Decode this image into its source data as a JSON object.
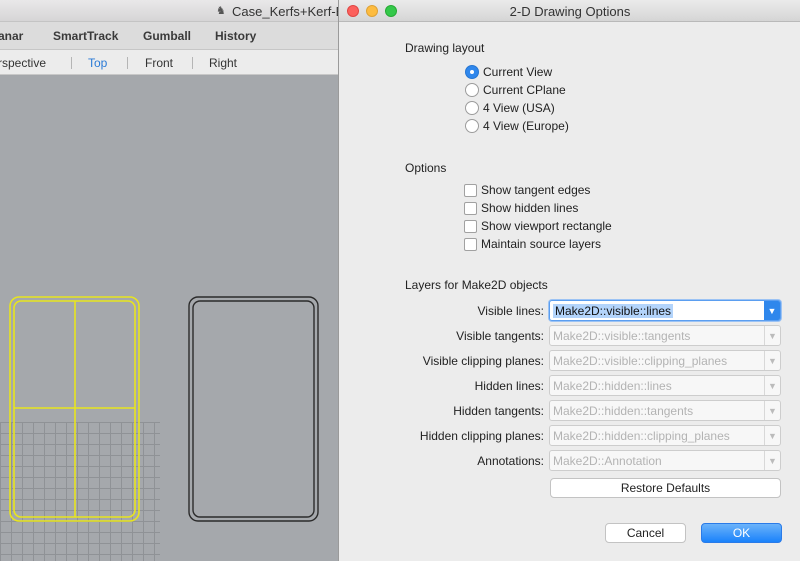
{
  "background_window": {
    "title": "Case_Kerfs+Kerf-Be",
    "toolbar": [
      "anar",
      "SmartTrack",
      "Gumball",
      "History"
    ],
    "view_tabs": [
      "rspective",
      "Top",
      "Front",
      "Right"
    ],
    "active_view": "Top",
    "colors": {
      "selected_curve": "#e8e51e",
      "curve": "#2b2b2b",
      "viewport": "#a5a8ac"
    }
  },
  "dialog": {
    "title": "2-D Drawing Options",
    "drawing_layout": {
      "heading": "Drawing layout",
      "options": [
        "Current View",
        "Current CPlane",
        "4 View (USA)",
        "4 View (Europe)"
      ],
      "selected_index": 0
    },
    "options": {
      "heading": "Options",
      "items": [
        {
          "label": "Show tangent edges",
          "checked": false
        },
        {
          "label": "Show hidden lines",
          "checked": false
        },
        {
          "label": "Show viewport rectangle",
          "checked": false
        },
        {
          "label": "Maintain source layers",
          "checked": false
        }
      ]
    },
    "layers": {
      "heading": "Layers for Make2D objects",
      "rows": [
        {
          "label": "Visible lines:",
          "value": "Make2D::visible::lines",
          "enabled": true
        },
        {
          "label": "Visible tangents:",
          "value": "Make2D::visible::tangents",
          "enabled": false
        },
        {
          "label": "Visible clipping planes:",
          "value": "Make2D::visible::clipping_planes",
          "enabled": false
        },
        {
          "label": "Hidden lines:",
          "value": "Make2D::hidden::lines",
          "enabled": false
        },
        {
          "label": "Hidden tangents:",
          "value": "Make2D::hidden::tangents",
          "enabled": false
        },
        {
          "label": "Hidden clipping planes:",
          "value": "Make2D::hidden::clipping_planes",
          "enabled": false
        },
        {
          "label": "Annotations:",
          "value": "Make2D::Annotation",
          "enabled": false
        }
      ]
    },
    "restore_defaults_label": "Restore Defaults",
    "cancel_label": "Cancel",
    "ok_label": "OK",
    "colors": {
      "accent": "#2f87ec"
    }
  }
}
